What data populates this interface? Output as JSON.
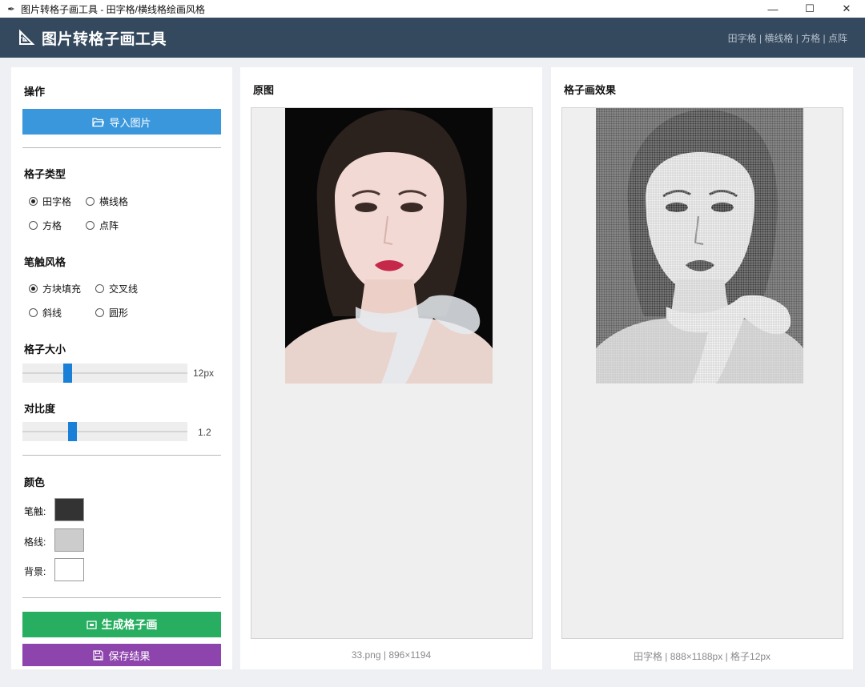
{
  "window": {
    "title": "图片转格子画工具 - 田字格/横线格绘画风格",
    "minimize_symbol": "—",
    "maximize_symbol": "☐",
    "close_symbol": "✕"
  },
  "header": {
    "title": "图片转格子画工具",
    "tagline": "田字格 | 横线格 | 方格 | 点阵",
    "background": "#34495e"
  },
  "sidebar": {
    "operations_title": "操作",
    "import_button": "导入图片",
    "grid_type": {
      "title": "格子类型",
      "options": [
        "田字格",
        "横线格",
        "方格",
        "点阵"
      ],
      "selected": "田字格"
    },
    "stroke_style": {
      "title": "笔触风格",
      "options": [
        "方块填充",
        "交叉线",
        "斜线",
        "圆形"
      ],
      "selected": "方块填充"
    },
    "grid_size": {
      "title": "格子大小",
      "value_label": "12px",
      "fraction": 0.26
    },
    "contrast": {
      "title": "对比度",
      "value_label": "1.2",
      "fraction": 0.29
    },
    "colors": {
      "title": "颜色",
      "stroke_label": "笔触:",
      "grid_label": "格线:",
      "background_label": "背景:",
      "stroke_color": "#333333",
      "grid_color": "#cccccc",
      "background_color": "#ffffff"
    },
    "generate_button": "生成格子画",
    "save_button": "保存结果"
  },
  "original_panel": {
    "title": "原图",
    "caption": "33.png | 896×1194"
  },
  "result_panel": {
    "title": "格子画效果",
    "caption": "田字格 | 888×1188px | 格子12px"
  },
  "colors": {
    "import_button": "#3a97dc",
    "generate_button": "#27ae60",
    "save_button": "#8e44ad",
    "slider_thumb": "#1a7fd6"
  }
}
